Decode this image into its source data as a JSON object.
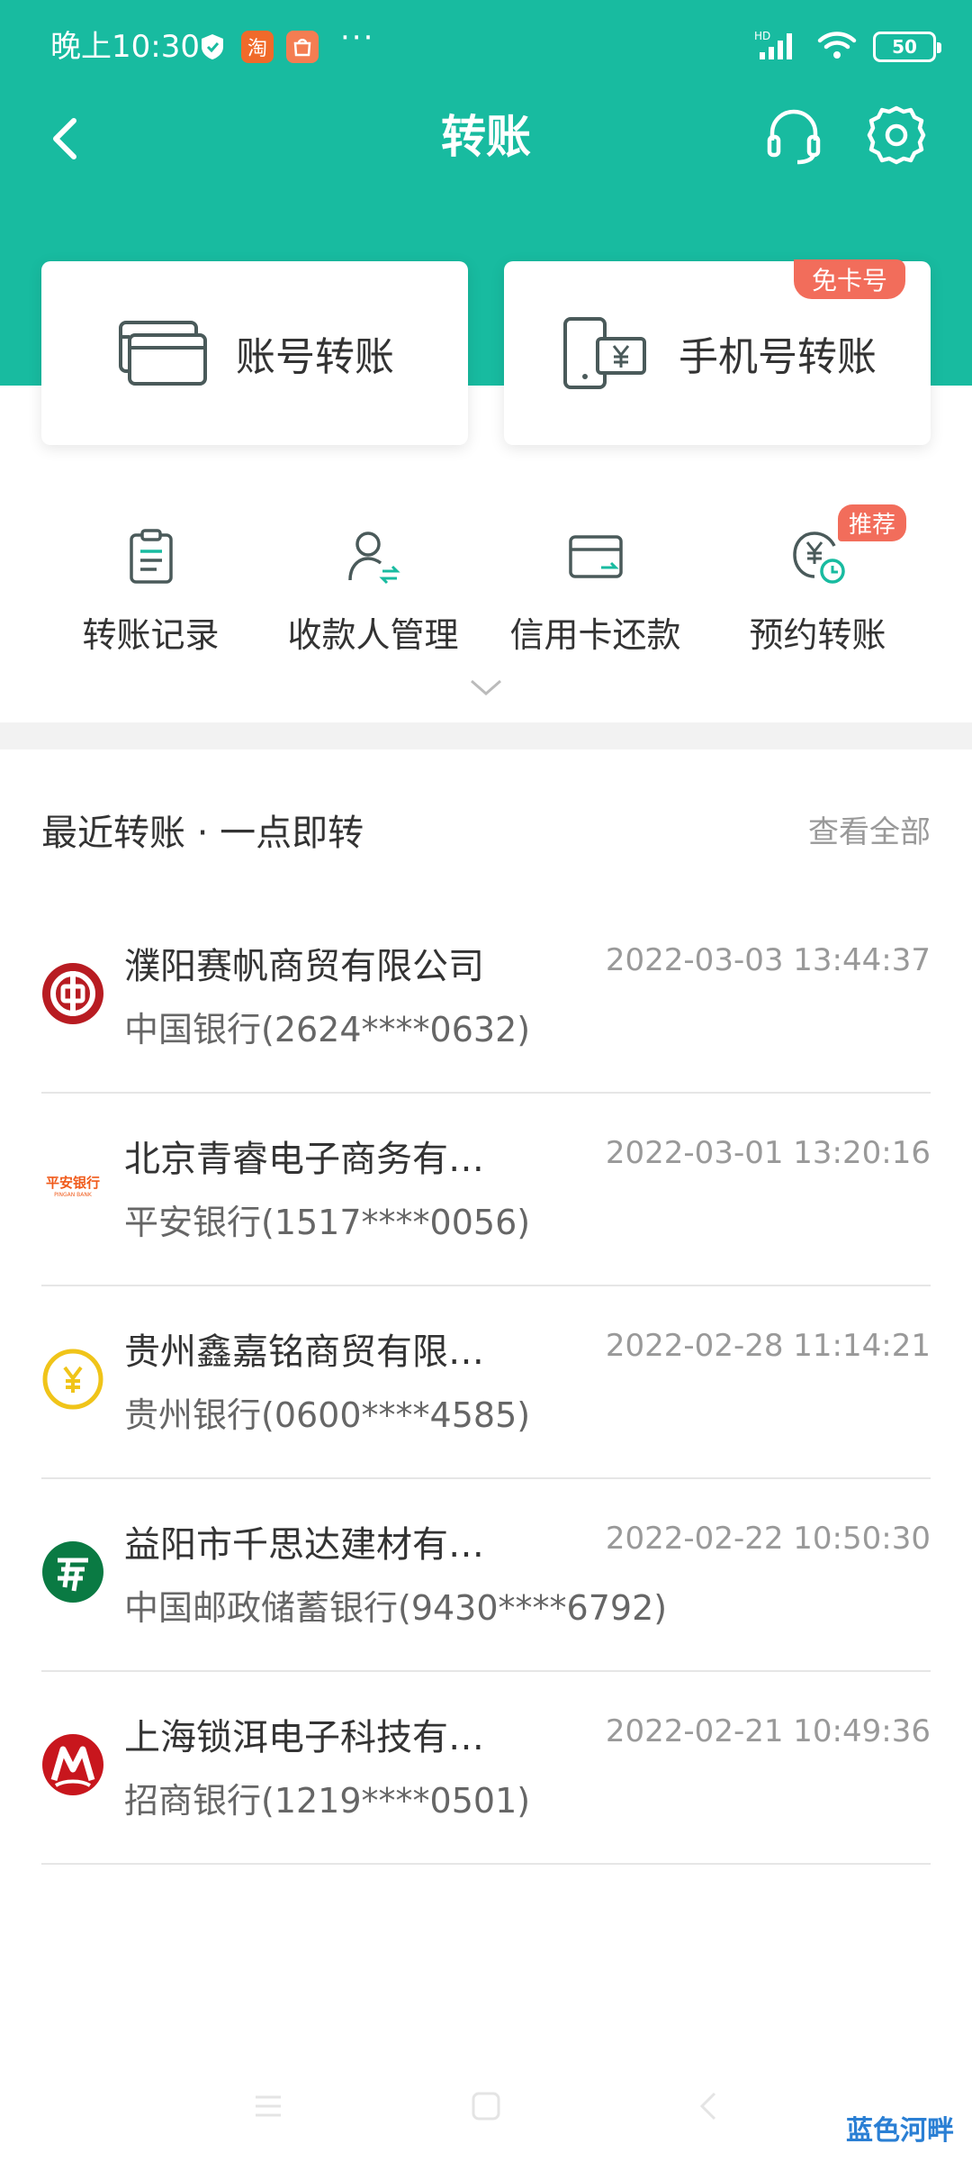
{
  "status_bar": {
    "time": "晚上10:30",
    "taobao_icon": "淘",
    "dots": "···",
    "network": "HD",
    "battery": "50"
  },
  "nav": {
    "title": "转账"
  },
  "cards": {
    "account_transfer": "账号转账",
    "phone_transfer": "手机号转账",
    "phone_badge": "免卡号"
  },
  "quick_actions": [
    {
      "label": "转账记录",
      "icon": "clipboard-icon"
    },
    {
      "label": "收款人管理",
      "icon": "payee-icon"
    },
    {
      "label": "信用卡还款",
      "icon": "credit-card-icon"
    },
    {
      "label": "预约转账",
      "icon": "scheduled-transfer-icon",
      "badge": "推荐"
    }
  ],
  "recent": {
    "title": "最近转账 · 一点即转",
    "view_all": "查看全部",
    "items": [
      {
        "name": "濮阳赛帆商贸有限公司",
        "date": "2022-03-03 13:44:37",
        "bank": "中国银行(2624****0632)",
        "logo": "boc-logo"
      },
      {
        "name": "北京青睿电子商务有…",
        "date": "2022-03-01 13:20:16",
        "bank": "平安银行(1517****0056)",
        "logo": "pingan-logo",
        "logo_text": "平安银行",
        "logo_subtext": "PINGAN BANK"
      },
      {
        "name": "贵州鑫嘉铭商贸有限…",
        "date": "2022-02-28 11:14:21",
        "bank": "贵州银行(0600****4585)",
        "logo": "yuan-coin-logo"
      },
      {
        "name": "益阳市千思达建材有…",
        "date": "2022-02-22 10:50:30",
        "bank": "中国邮政储蓄银行(9430****6792)",
        "logo": "psbc-logo"
      },
      {
        "name": "上海锁洱电子科技有…",
        "date": "2022-02-21 10:49:36",
        "bank": "招商银行(1219****0501)",
        "logo": "cmb-logo"
      }
    ]
  },
  "watermark": "蓝色河畔",
  "colors": {
    "primary": "#18bba0",
    "badge": "#f26d5b",
    "icon_stroke": "#4a5a5a"
  }
}
